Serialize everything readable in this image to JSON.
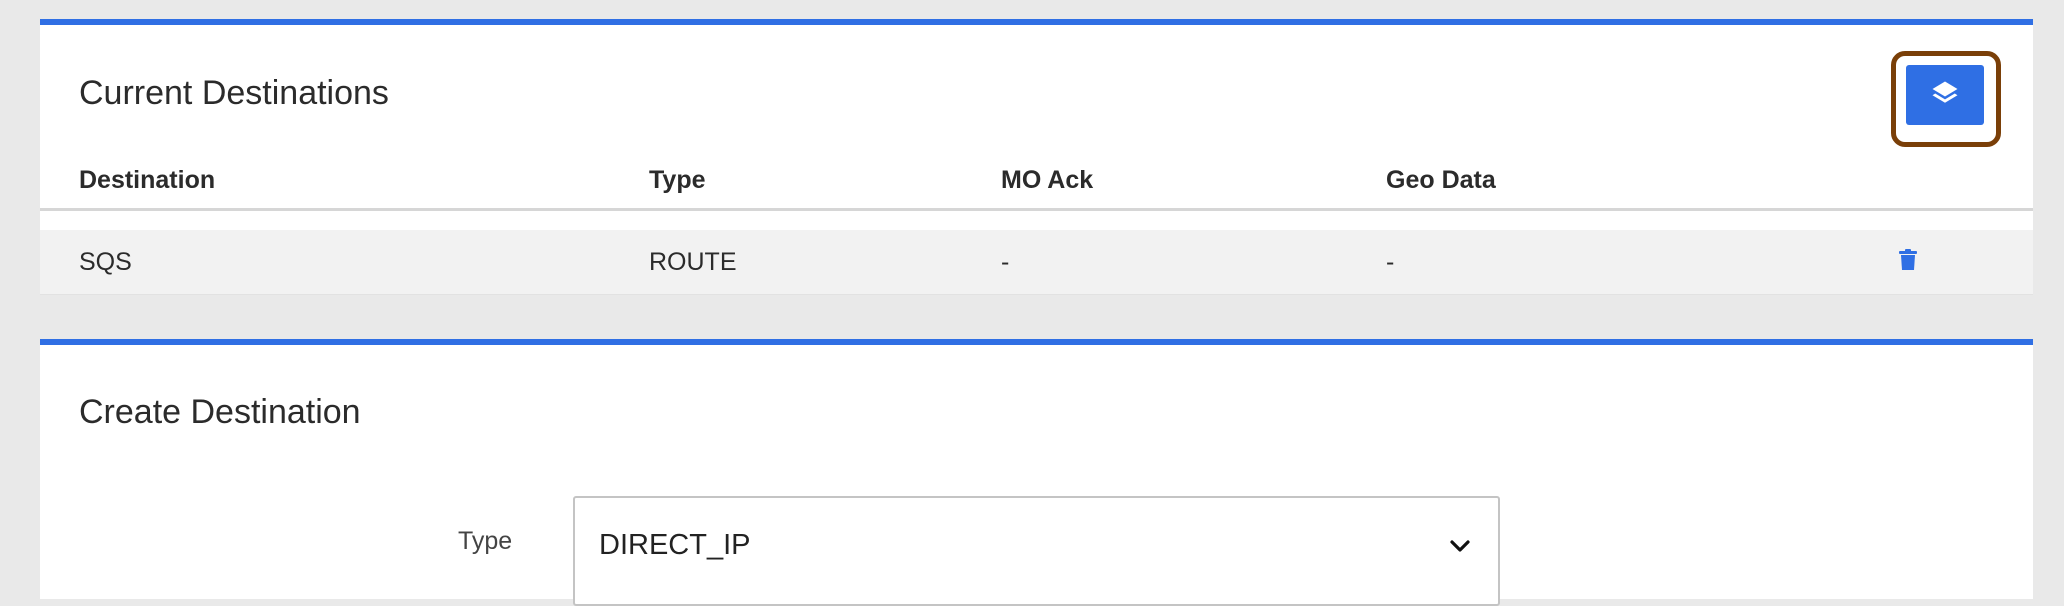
{
  "current_destinations": {
    "title": "Current Destinations",
    "columns": [
      "Destination",
      "Type",
      "MO Ack",
      "Geo Data"
    ],
    "rows": [
      {
        "destination": "SQS",
        "type": "ROUTE",
        "mo_ack": "-",
        "geo_data": "-",
        "action_icon": "trash-icon"
      }
    ],
    "header_action_icon": "layers-icon"
  },
  "create_destination": {
    "title": "Create Destination",
    "type_label": "Type",
    "type_value": "DIRECT_IP",
    "type_icon": "chevron-down-icon"
  },
  "colors": {
    "accent": "#2f6fe4",
    "highlight": "#7a3f08",
    "page_background": "#e9e9e9",
    "row_background": "#f2f2f2"
  }
}
